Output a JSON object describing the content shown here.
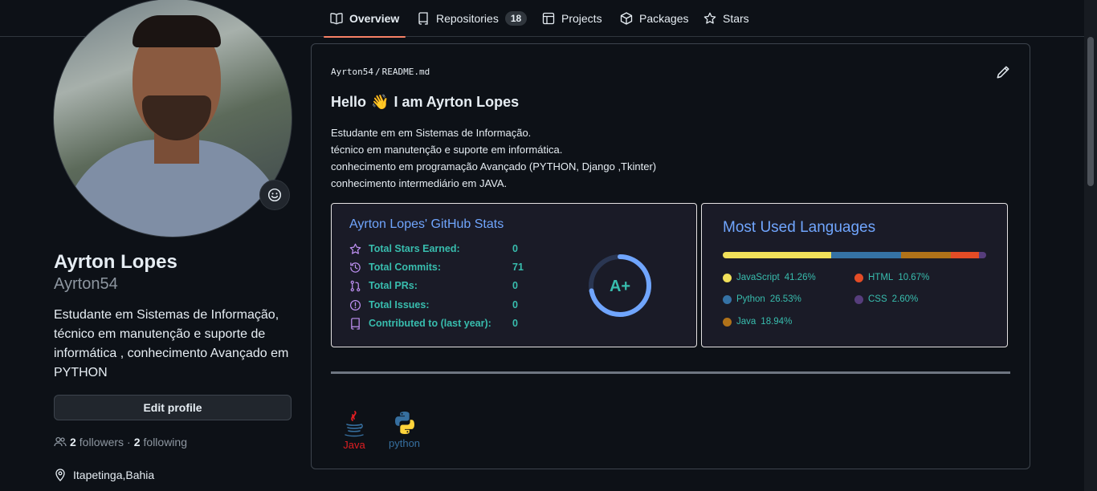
{
  "nav": {
    "tabs": [
      {
        "label": "Overview",
        "icon": "book-icon",
        "active": true
      },
      {
        "label": "Repositories",
        "icon": "repo-icon",
        "count": "18"
      },
      {
        "label": "Projects",
        "icon": "table-icon"
      },
      {
        "label": "Packages",
        "icon": "package-icon"
      },
      {
        "label": "Stars",
        "icon": "star-icon"
      }
    ]
  },
  "profile": {
    "name": "Ayrton Lopes",
    "username": "Ayrton54",
    "bio": "Estudante em Sistemas de Informação, técnico em manutenção e suporte de informática , conhecimento Avançado em PYTHON",
    "edit_label": "Edit profile",
    "followers_count": "2",
    "followers_label": "followers",
    "separator": "·",
    "following_count": "2",
    "following_label": "following",
    "location": "Itapetinga,Bahia"
  },
  "readme": {
    "owner": "Ayrton54",
    "slash": "/",
    "file": "README.md",
    "heading_prefix": "Hello",
    "heading_emoji": "👋",
    "heading_suffix": "I am Ayrton Lopes",
    "lines": [
      "Estudante em em Sistemas de Informação.",
      "técnico em manutenção e suporte em informática.",
      "conhecimento em programação Avançado (PYTHON, Django ,Tkinter)",
      "conhecimento intermediário em JAVA."
    ]
  },
  "stats_card": {
    "title": "Ayrton Lopes' GitHub Stats",
    "rows": [
      {
        "label": "Total Stars Earned:",
        "value": "0",
        "icon": "star-icon"
      },
      {
        "label": "Total Commits:",
        "value": "71",
        "icon": "history-icon"
      },
      {
        "label": "Total PRs:",
        "value": "0",
        "icon": "pull-request-icon"
      },
      {
        "label": "Total Issues:",
        "value": "0",
        "icon": "issue-icon"
      },
      {
        "label": "Contributed to (last year):",
        "value": "0",
        "icon": "repo-icon"
      }
    ],
    "rank": "A+",
    "rank_fraction": 0.72,
    "colors": {
      "title": "#70a5fd",
      "text": "#38bdae",
      "icon": "#bf91f3",
      "bg": "#1a1b27"
    }
  },
  "languages_card": {
    "title": "Most Used Languages",
    "languages": [
      {
        "name": "JavaScript",
        "percent": "41.26%",
        "value": 41.26,
        "color": "#f1e05a"
      },
      {
        "name": "Python",
        "percent": "26.53%",
        "value": 26.53,
        "color": "#3572a5"
      },
      {
        "name": "Java",
        "percent": "18.94%",
        "value": 18.94,
        "color": "#b07219"
      },
      {
        "name": "HTML",
        "percent": "10.67%",
        "value": 10.67,
        "color": "#e34c26"
      },
      {
        "name": "CSS",
        "percent": "2.60%",
        "value": 2.6,
        "color": "#563d7c"
      }
    ]
  },
  "tech_icons": [
    {
      "label": "Java",
      "icon": "java-logo-icon",
      "color": "#e11e22"
    },
    {
      "label": "python",
      "icon": "python-logo-icon",
      "color": "#366f9f"
    }
  ]
}
